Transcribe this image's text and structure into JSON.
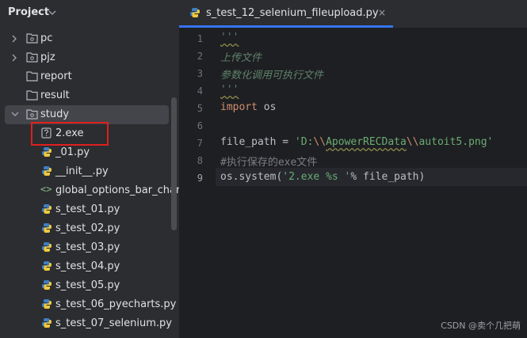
{
  "project": {
    "title": "Project",
    "items": [
      {
        "label": "pc",
        "type": "folder",
        "collapsed": true
      },
      {
        "label": "pjz",
        "type": "folder",
        "collapsed": true
      },
      {
        "label": "report",
        "type": "folder"
      },
      {
        "label": "result",
        "type": "folder"
      },
      {
        "label": "study",
        "type": "folder",
        "expanded": true
      },
      {
        "label": "2.exe",
        "type": "unknown-file"
      },
      {
        "label": "_01.py",
        "type": "python-file"
      },
      {
        "label": "__init__.py",
        "type": "python-file"
      },
      {
        "label": "global_options_bar_chart.",
        "type": "html-file"
      },
      {
        "label": "s_test_01.py",
        "type": "python-file"
      },
      {
        "label": "s_test_02.py",
        "type": "python-file"
      },
      {
        "label": "s_test_03.py",
        "type": "python-file"
      },
      {
        "label": "s_test_04.py",
        "type": "python-file"
      },
      {
        "label": "s_test_05.py",
        "type": "python-file"
      },
      {
        "label": "s_test_06_pyecharts.py",
        "type": "python-file"
      },
      {
        "label": "s_test_07_selenium.py",
        "type": "python-file"
      }
    ]
  },
  "editor": {
    "tab_label": "s_test_12_selenium_fileupload.py",
    "tab_close": "×",
    "line_numbers": [
      "1",
      "2",
      "3",
      "4",
      "5",
      "6",
      "7",
      "8",
      "9"
    ],
    "code": {
      "l1": "'''",
      "l2": "上传文件",
      "l3": "参数化调用可执行文件",
      "l4": "'''",
      "l5_kw": "import",
      "l5_rest": " os",
      "l7_a": "file_path = ",
      "l7_s1": "'D:",
      "l7_e1": "\\\\",
      "l7_s2": "ApowerRECData",
      "l7_e2": "\\\\",
      "l7_s3": "autoit5.png'",
      "l8": "#执行保存的exe文件",
      "l9_a": "os.system(",
      "l9_s": "'2.exe %s '",
      "l9_b": "% file_path)"
    }
  },
  "watermark": "CSDN @卖个几把萌",
  "colors": {
    "accent": "#3574f0",
    "highlight_box": "#e01f1f"
  }
}
